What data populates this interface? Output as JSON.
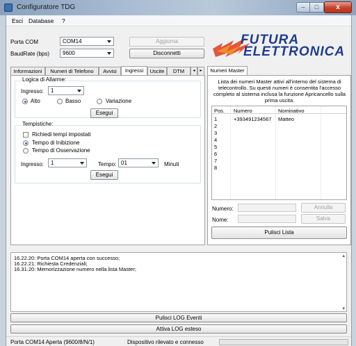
{
  "window": {
    "title": "Configuratore TDG",
    "close_glyph": "x",
    "min_glyph": "–",
    "max_glyph": "□",
    "icon": "app-icon"
  },
  "menu": [
    "Esci",
    "Database",
    "?"
  ],
  "connection": {
    "porta_label": "Porta COM",
    "porta_value": "COM14",
    "baud_label": "BaudRate (bps)",
    "baud_value": "9600",
    "aggiorna_label": "Aggiorna",
    "disconnetti_label": "Disconnetti"
  },
  "logo": {
    "line1": "FUTURA",
    "line2": "ELETTRONICA",
    "color": "#1f3c8e",
    "accent": "#e23b1a"
  },
  "tabs": [
    "Informazioni",
    "Numeri di Telefono",
    "Avvisi",
    "Ingressi",
    "Uscite",
    "DTM"
  ],
  "tab_scroll": [
    "◂",
    "▸"
  ],
  "active_tab": "Ingressi",
  "logica": {
    "title": "Logica di Allarme:",
    "ingresso_label": "Ingresso:",
    "ingresso_value": "1",
    "options": [
      "Alto",
      "Basso",
      "Variazione"
    ],
    "selected": "Alto",
    "esegui": "Esegui"
  },
  "tempistiche": {
    "title": "Tempistiche:",
    "check_label": "Richiedi tempi impostati",
    "options": [
      "Tempo di Inibizione",
      "Tempo di Osservazione"
    ],
    "selected": "Tempo di Inibizione",
    "ingresso_label": "Ingresso:",
    "ingresso_value": "1",
    "tempo_label": "Tempo:",
    "tempo_value": "01",
    "unit": "Minuti",
    "esegui": "Esegui"
  },
  "master": {
    "tab": "Numeri Master",
    "description": "Lista dei numeri Master attivi all'interno del sistema di telecontrollo. Su questi numeri è consentita l'accesso completo al sistema inclusa la funzione Apricancello sulla prima uscita.",
    "columns": [
      "Pos.",
      "Numero",
      "Nominativo"
    ],
    "rows": [
      {
        "pos": "1",
        "numero": "+393491234567",
        "nome": "Matteo"
      },
      {
        "pos": "2",
        "numero": "",
        "nome": ""
      },
      {
        "pos": "3",
        "numero": "",
        "nome": ""
      },
      {
        "pos": "4",
        "numero": "",
        "nome": ""
      },
      {
        "pos": "5",
        "numero": "",
        "nome": ""
      },
      {
        "pos": "6",
        "numero": "",
        "nome": ""
      },
      {
        "pos": "7",
        "numero": "",
        "nome": ""
      },
      {
        "pos": "8",
        "numero": "",
        "nome": ""
      }
    ],
    "numero_label": "Numero:",
    "nome_label": "Nome:",
    "annulla": "Annulla",
    "salva": "Salva",
    "pulisci": "Pulisci Lista"
  },
  "log": {
    "lines": [
      "16.22.20: Porta COM14 aperta con successo;",
      "16.22.21: Richiesta Credenziali;",
      "16.31.20: Memorizzazione numero nella lista Master;"
    ],
    "scroll_up": "▴",
    "scroll_down": "▾"
  },
  "buttons": {
    "pulisci_log": "Pulisci LOG Eventi",
    "attiva_log": "Attiva LOG esteso"
  },
  "status": {
    "left": "Porta COM14 Aperta (9600/8/N/1)",
    "right": "Dispositivo rilevato e connesso"
  }
}
